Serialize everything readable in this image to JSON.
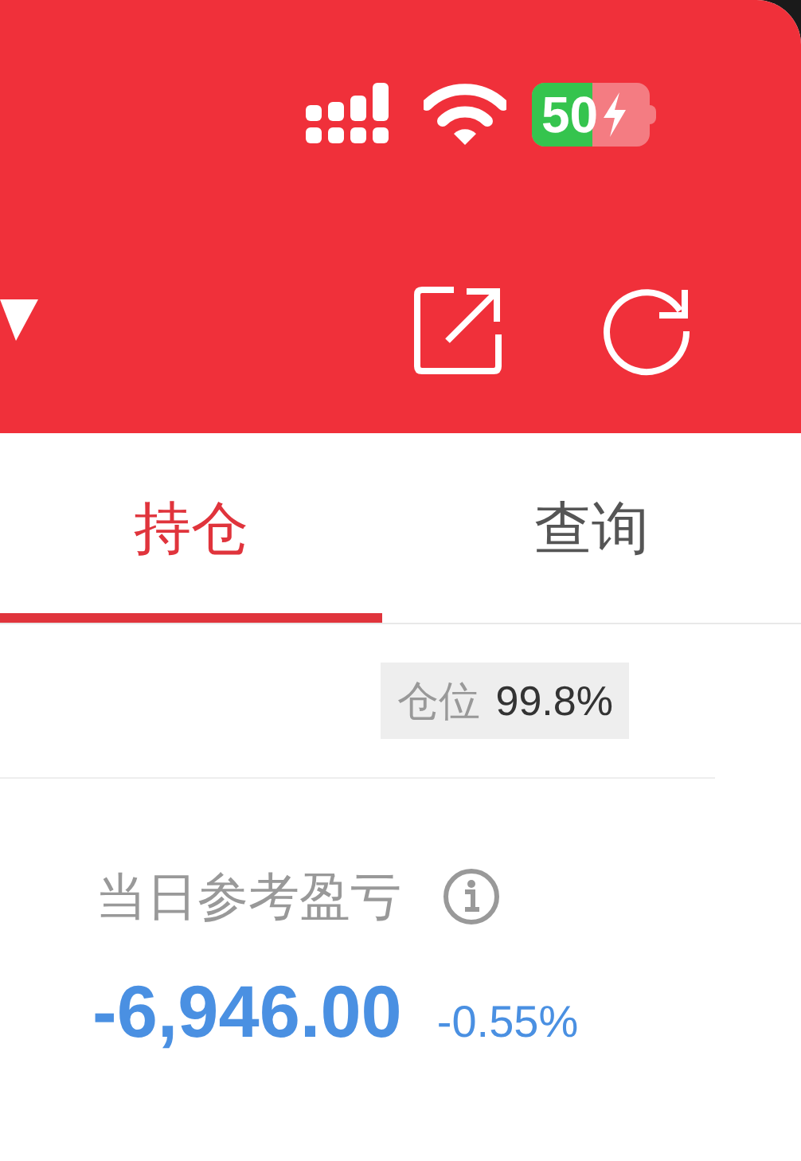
{
  "status_bar": {
    "battery": "50"
  },
  "tabs": [
    {
      "label": "持仓",
      "selected": true
    },
    {
      "label": "查询",
      "selected": false
    }
  ],
  "position": {
    "label": "仓位",
    "value": "99.8%"
  },
  "pnl": {
    "label": "当日参考盈亏",
    "value": "-6,946.00",
    "percent": "-0.55%"
  }
}
